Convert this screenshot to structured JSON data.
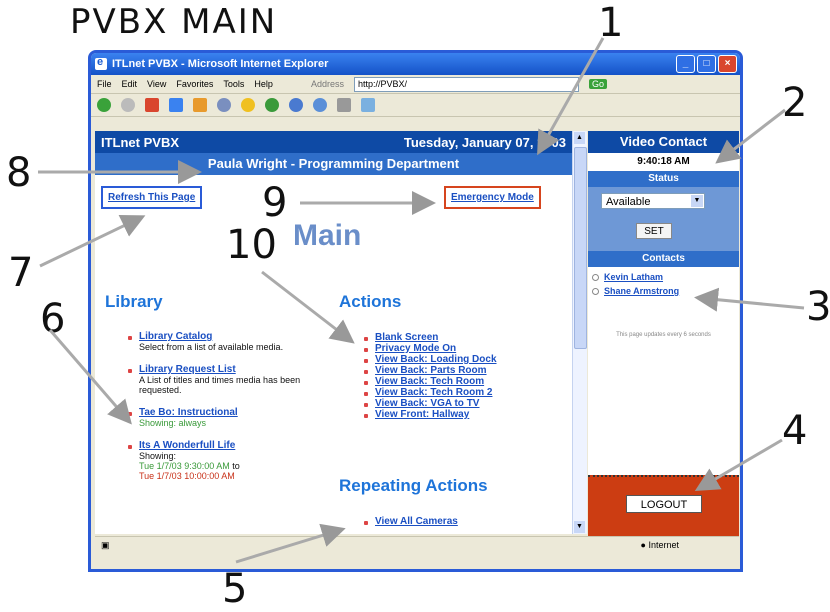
{
  "annotation": {
    "title": "PVBX MAIN",
    "callouts": [
      "1",
      "2",
      "3",
      "4",
      "5",
      "6",
      "7",
      "8",
      "9",
      "10"
    ]
  },
  "browser": {
    "title": "ITLnet PVBX - Microsoft Internet Explorer",
    "menu": [
      "File",
      "Edit",
      "View",
      "Favorites",
      "Tools",
      "Help"
    ],
    "address_label": "Address",
    "address": "http://PVBX/",
    "go_label": "Go",
    "status_zone": "Internet"
  },
  "page": {
    "app_name": "ITLnet PVBX",
    "date": "Tuesday, January 07, 2003",
    "user_line": "Paula Wright - Programming Department",
    "refresh_label": "Refresh This Page",
    "emergency_label": "Emergency Mode",
    "heading": "Main",
    "library": {
      "title": "Library",
      "items": [
        {
          "link": "Library Catalog",
          "desc": "Select from a list of available media."
        },
        {
          "link": "Library Request List",
          "desc": "A List of titles and times media has been requested."
        },
        {
          "link": "Tae Bo: Instructional",
          "desc": "Showing: always"
        },
        {
          "link": "Its A Wonderfull Life",
          "desc": "Showing:",
          "from": "Tue 1/7/03 9:30:00 AM",
          "to_word": "to",
          "to": "Tue 1/7/03 10:00:00 AM"
        }
      ]
    },
    "actions": {
      "title": "Actions",
      "items": [
        "Blank Screen",
        "Privacy Mode On",
        "View Back: Loading Dock",
        "View Back: Parts Room",
        "View Back: Tech Room",
        "View Back: Tech Room 2",
        "View Back: VGA to TV",
        "View Front: Hallway"
      ]
    },
    "repeating": {
      "title": "Repeating Actions",
      "items": [
        "View All Cameras"
      ]
    }
  },
  "panel": {
    "title": "Video Contact",
    "time": "9:40:18 AM",
    "status_title": "Status",
    "status_value": "Available",
    "set_label": "SET",
    "contacts_title": "Contacts",
    "contacts": [
      "Kevin Latham",
      "Shane Armstrong"
    ],
    "update_note": "This page updates every 6 seconds",
    "logout_label": "LOGOUT"
  }
}
